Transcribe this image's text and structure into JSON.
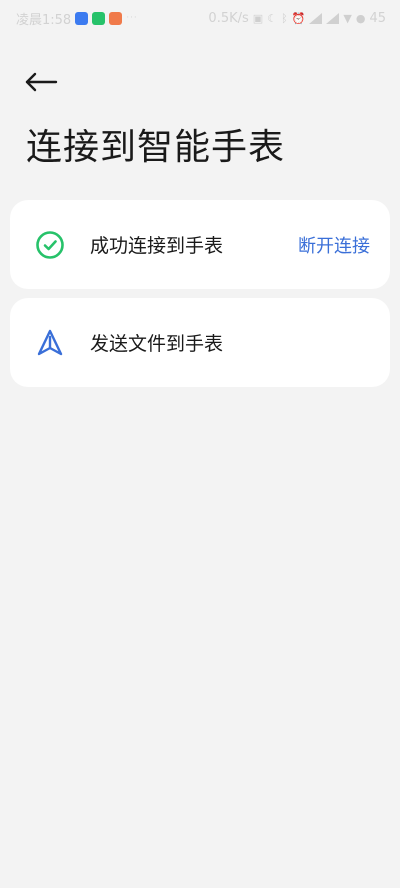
{
  "status_bar": {
    "time": "凌晨1:58",
    "more_dots": "···",
    "net_speed": "0.5K/s",
    "battery": "45"
  },
  "header": {
    "title": "连接到智能手表"
  },
  "cards": {
    "connected": {
      "label": "成功连接到手表",
      "action": "断开连接",
      "icon": "check-circle-icon",
      "icon_color": "#27c26a"
    },
    "send": {
      "label": "发送文件到手表",
      "icon": "navigation-arrow-icon",
      "icon_color": "#3a6fd8"
    }
  },
  "colors": {
    "background": "#f3f3f3",
    "card": "#ffffff",
    "accent": "#3a6fd8"
  }
}
